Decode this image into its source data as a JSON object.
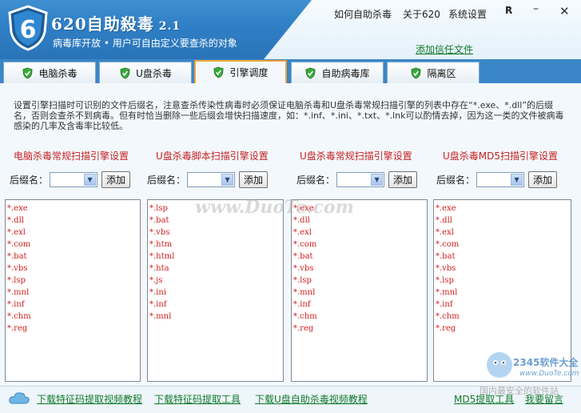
{
  "app": {
    "logo_digit": "6",
    "title": "620自助殺毒",
    "version": "2.1",
    "subtitle": "病毒库开放 • 用户可自由定义要查杀的对象"
  },
  "header_links": {
    "how_to": "如何自助杀毒",
    "about": "关于620",
    "settings": "系统设置",
    "trust_file": "添加信任文件"
  },
  "window_controls": {
    "restore": "R",
    "minimize": "–",
    "close": "✕"
  },
  "tabs": [
    {
      "label": "电脑杀毒",
      "active": false
    },
    {
      "label": "U盘杀毒",
      "active": false
    },
    {
      "label": "引擎调度",
      "active": true
    },
    {
      "label": "自助病毒库",
      "active": false
    },
    {
      "label": "隔离区",
      "active": false
    }
  ],
  "description": "设置引擎扫描时可识别的文件后缀名，注意查杀传染性病毒时必须保证电脑杀毒和U盘杀毒常规扫描引擎的列表中存在“*.exe、*.dll”的后缀名，否则会查杀不到病毒。但有时恰当删除一些后缀会增快扫描速度，如：*.inf、*.ini、*.txt、*.lnk可以酌情去掉，因为这一类的文件被病毒感染的几率及含毒率比较低。",
  "suffix_label": "后缀名：",
  "add_button": "添加",
  "columns": [
    {
      "title": "电脑杀毒常规扫描引擎设置",
      "items": [
        "*.exe",
        "*.dll",
        "*.exl",
        "*.com",
        "*.bat",
        "*.vbs",
        "*.lsp",
        "*.mnl",
        "*.inf",
        "*.chm",
        "*.reg"
      ]
    },
    {
      "title": "U盘杀毒脚本扫描引擎设置",
      "items": [
        "*.lsp",
        "*.bat",
        "*.vbs",
        "*.htm",
        "*.html",
        "*.hta",
        "*.js",
        "*.ini",
        "*.inf",
        "*.mnl"
      ]
    },
    {
      "title": "U盘杀毒常规扫描引擎设置",
      "items": [
        "*.exe",
        "*.dll",
        "*.exl",
        "*.com",
        "*.bat",
        "*.vbs",
        "*.lsp",
        "*.mnl",
        "*.inf",
        "*.chm",
        "*.reg"
      ]
    },
    {
      "title": "U盘杀毒MD5扫描引擎设置",
      "items": [
        "*.exe",
        "*.dll",
        "*.exl",
        "*.com",
        "*.bat",
        "*.vbs",
        "*.lsp",
        "*.mnl",
        "*.inf",
        "*.chm",
        "*.reg"
      ]
    }
  ],
  "footer_links": {
    "video_tutorial": "下载特征码提取视频教程",
    "extract_tool": "下载特征码提取工具",
    "usb_video": "下载U盘自助杀毒视频教程",
    "md5_tool": "MD5提取工具",
    "feedback": "我要留言"
  },
  "watermarks": {
    "center": "www.DuoTe.com",
    "brand": "2345软件大全",
    "brand_url": "www.DuoTe.com",
    "footer": "国内最安全的软件站"
  }
}
